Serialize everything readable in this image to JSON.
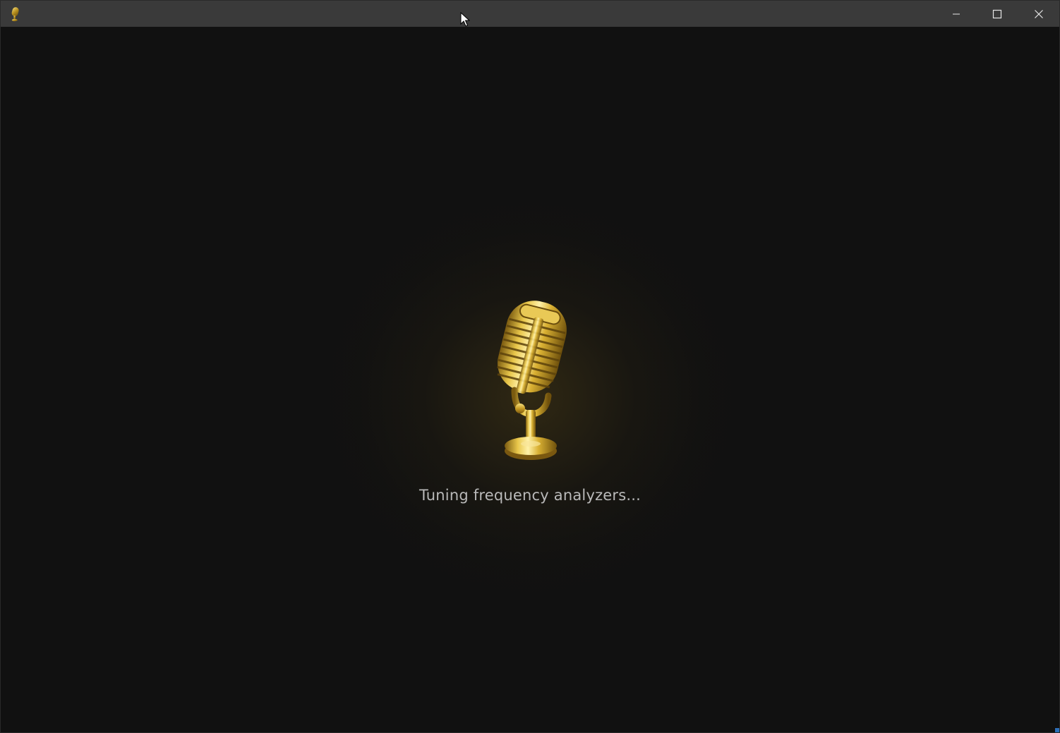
{
  "window": {
    "app_icon": "microphone-icon",
    "controls": {
      "minimize": "minimize-icon",
      "maximize": "maximize-icon",
      "close": "close-icon"
    }
  },
  "splash": {
    "logo": "golden-microphone-icon",
    "status_text": "Tuning frequency analyzers..."
  },
  "colors": {
    "titlebar": "#3a3a3a",
    "background": "#111111",
    "gold": "#d4a92a",
    "text": "#b9b9b9"
  }
}
